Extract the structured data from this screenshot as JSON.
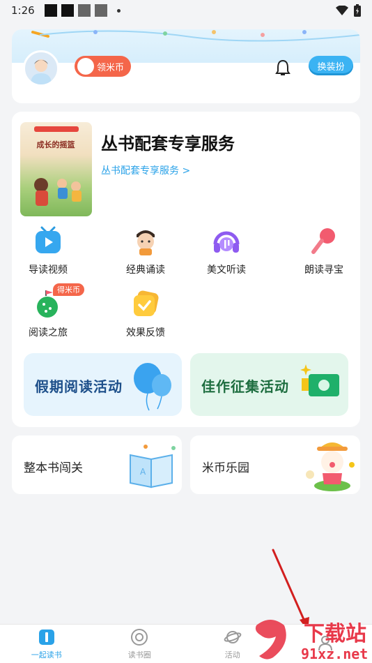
{
  "status_bar": {
    "time": "1:26"
  },
  "profile": {
    "coin_label": "领米币",
    "dress_button": "换装扮"
  },
  "service": {
    "title": "丛书配套专享服务",
    "link": "丛书配套专享服务 >",
    "book_cover_title": "成长的摇篮",
    "grid": [
      {
        "label": "导读视频",
        "icon": "tv-icon"
      },
      {
        "label": "经典诵读",
        "icon": "reading-boy-icon"
      },
      {
        "label": "美文听读",
        "icon": "headphones-icon"
      },
      {
        "label": "朗读寻宝",
        "icon": "microphone-icon"
      },
      {
        "label": "阅读之旅",
        "icon": "journey-icon",
        "badge": "得米币"
      },
      {
        "label": "效果反馈",
        "icon": "check-badge-icon"
      }
    ],
    "activities": [
      {
        "label": "假期阅读活动"
      },
      {
        "label": "佳作征集活动"
      }
    ]
  },
  "mini_cards": [
    {
      "label": "整本书闯关"
    },
    {
      "label": "米币乐园"
    }
  ],
  "bottom_nav": [
    {
      "label": "一起读书",
      "active": true
    },
    {
      "label": "读书圈",
      "active": false
    },
    {
      "label": "活动",
      "active": false
    }
  ],
  "watermark": {
    "brand": "下载站",
    "url": "91xz.net"
  },
  "colors": {
    "accent": "#2aa2e8",
    "coin": "#f4664a",
    "annotation_arrow": "#d21f1f"
  }
}
